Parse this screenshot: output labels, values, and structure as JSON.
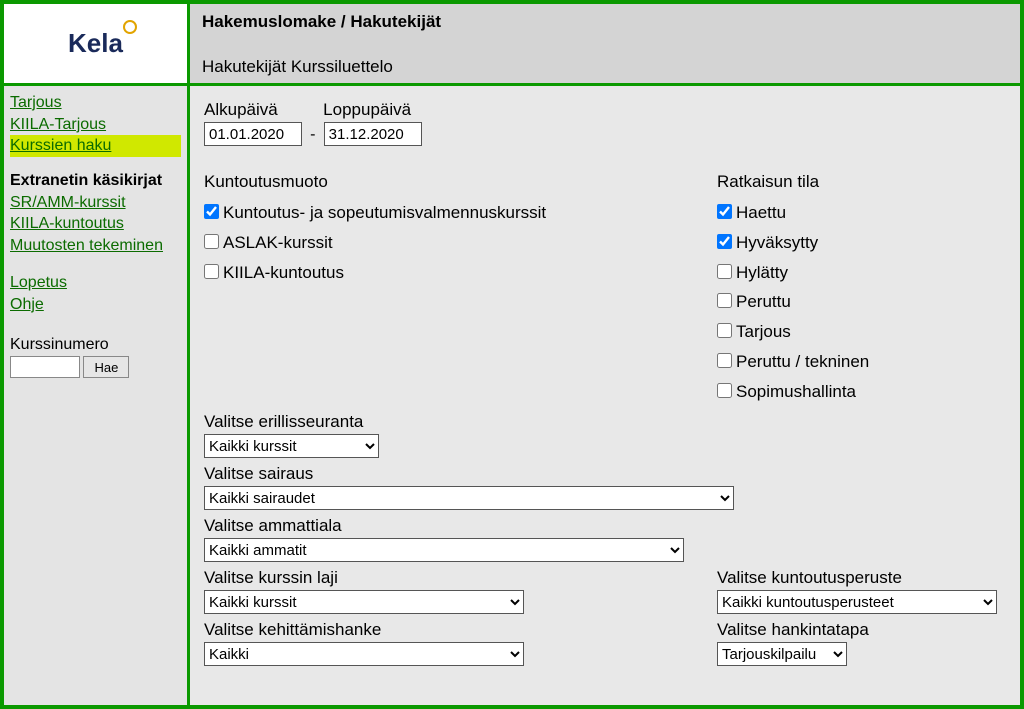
{
  "logo": "Kela",
  "header": {
    "title": "Hakemuslomake / Hakutekijät",
    "subtitle": "Hakutekijät Kurssiluettelo"
  },
  "nav": {
    "links1": [
      "Tarjous",
      "KIILA-Tarjous",
      "Kurssien haku"
    ],
    "section_head": "Extranetin käsikirjat",
    "links2": [
      "SR/AMM-kurssit",
      "KIILA-kuntoutus",
      "Muutosten tekeminen"
    ],
    "links3": [
      "Lopetus",
      "Ohje"
    ],
    "kurssinumero_label": "Kurssinumero",
    "hae_label": "Hae",
    "kurssinumero_value": ""
  },
  "dates": {
    "start_label": "Alkupäivä",
    "end_label": "Loppupäivä",
    "start_value": "01.01.2020",
    "end_value": "31.12.2020"
  },
  "kuntoutusmuoto": {
    "label": "Kuntoutusmuoto",
    "items": [
      {
        "label": "Kuntoutus- ja sopeutumisvalmennuskurssit",
        "checked": true
      },
      {
        "label": "ASLAK-kurssit",
        "checked": false
      },
      {
        "label": "KIILA-kuntoutus",
        "checked": false
      }
    ]
  },
  "ratkaisun_tila": {
    "label": "Ratkaisun tila",
    "items": [
      {
        "label": "Haettu",
        "checked": true
      },
      {
        "label": "Hyväksytty",
        "checked": true
      },
      {
        "label": "Hylätty",
        "checked": false
      },
      {
        "label": "Peruttu",
        "checked": false
      },
      {
        "label": "Tarjous",
        "checked": false
      },
      {
        "label": "Peruttu / tekninen",
        "checked": false
      },
      {
        "label": "Sopimushallinta",
        "checked": false
      }
    ]
  },
  "selects": {
    "erillisseuranta": {
      "label": "Valitse erillisseuranta",
      "value": "Kaikki kurssit"
    },
    "sairaus": {
      "label": "Valitse sairaus",
      "value": "Kaikki sairaudet"
    },
    "ammattiala": {
      "label": "Valitse ammattiala",
      "value": "Kaikki ammatit"
    },
    "kurssin_laji": {
      "label": "Valitse kurssin laji",
      "value": "Kaikki kurssit"
    },
    "kuntoutusperuste": {
      "label": "Valitse kuntoutusperuste",
      "value": "Kaikki kuntoutusperusteet"
    },
    "kehittamishanke": {
      "label": "Valitse kehittämishanke",
      "value": "Kaikki"
    },
    "hankintatapa": {
      "label": "Valitse hankintatapa",
      "value": "Tarjouskilpailu"
    }
  }
}
